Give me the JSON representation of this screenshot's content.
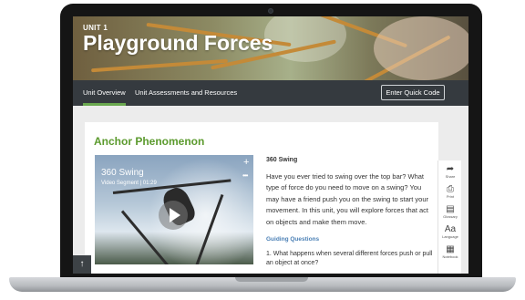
{
  "hero": {
    "unit_label": "UNIT 1",
    "title": "Playground Forces"
  },
  "nav": {
    "tabs": [
      {
        "label": "Unit Overview",
        "active": true
      },
      {
        "label": "Unit Assessments and Resources",
        "active": false
      }
    ],
    "quick_code_label": "Enter Quick Code"
  },
  "main": {
    "section_title": "Anchor Phenomenon",
    "video": {
      "title": "360 Swing",
      "meta": "Video Segment  |  01:29",
      "add_icon": "plus-icon",
      "more_icon": "ellipsis-icon",
      "play_icon": "play-icon"
    },
    "segment_title": "360 Swing",
    "body": "Have you ever tried to swing over the top bar? What type of force do you need to move on a swing? You may have a friend push you on the swing to start your movement. In this unit, you will explore forces that act on objects and make them move.",
    "guiding_title": "Guiding Questions",
    "questions": [
      "1. What happens when several different forces push or pull an object at once?"
    ]
  },
  "tools": [
    {
      "label": "Share",
      "icon": "share-icon"
    },
    {
      "label": "Print",
      "icon": "print-icon"
    },
    {
      "label": "Glossary",
      "icon": "book-icon"
    },
    {
      "label": "Language",
      "icon": "language-icon"
    },
    {
      "label": "Notebook",
      "icon": "notebook-icon"
    }
  ],
  "scroll_top_icon": "arrow-up-icon",
  "colors": {
    "nav_bg": "#353a3f",
    "accent_green": "#5b9a2d",
    "link_blue": "#4a7fb5"
  }
}
